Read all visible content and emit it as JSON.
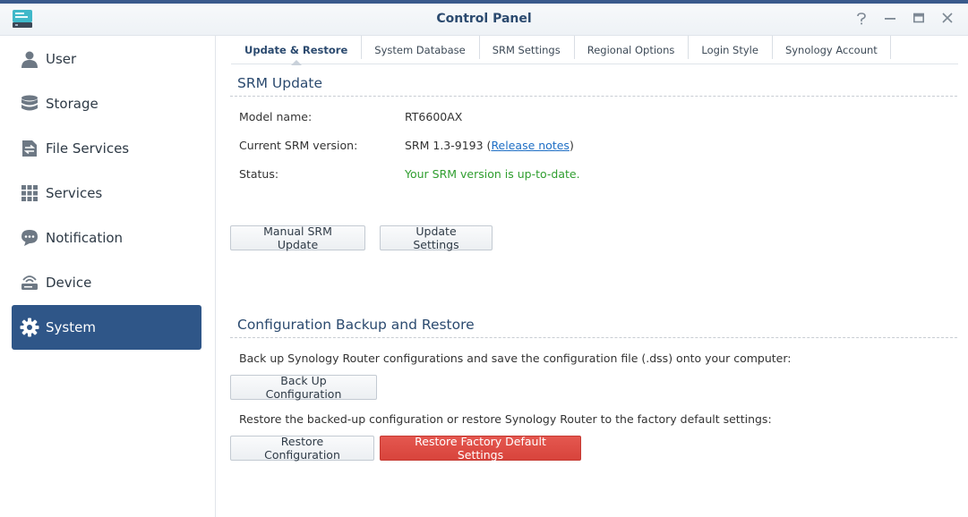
{
  "window": {
    "title": "Control Panel"
  },
  "sidebar": {
    "items": [
      {
        "label": "User",
        "icon": "user-icon"
      },
      {
        "label": "Storage",
        "icon": "storage-icon"
      },
      {
        "label": "File Services",
        "icon": "file-services-icon"
      },
      {
        "label": "Services",
        "icon": "grid-icon"
      },
      {
        "label": "Notification",
        "icon": "chat-bubble-icon"
      },
      {
        "label": "Device",
        "icon": "router-icon"
      },
      {
        "label": "System",
        "icon": "gear-icon",
        "active": true
      }
    ]
  },
  "tabs": [
    {
      "label": "Update & Restore",
      "active": true
    },
    {
      "label": "System Database"
    },
    {
      "label": "SRM Settings"
    },
    {
      "label": "Regional Options"
    },
    {
      "label": "Login Style"
    },
    {
      "label": "Synology Account"
    }
  ],
  "srm_update": {
    "title": "SRM Update",
    "model_label": "Model name:",
    "model_value": "RT6600AX",
    "version_label": "Current SRM version:",
    "version_prefix": "SRM 1.3-9193 (",
    "release_notes": "Release notes",
    "version_suffix": ")",
    "status_label": "Status:",
    "status_value": "Your SRM version is up-to-date.",
    "manual_update_button": "Manual SRM Update",
    "update_settings_button": "Update Settings"
  },
  "backup": {
    "title": "Configuration Backup and Restore",
    "backup_desc": "Back up Synology Router configurations and save the configuration file (.dss) onto your computer:",
    "backup_button": "Back Up Configuration",
    "restore_desc": "Restore the backed-up configuration or restore Synology Router to the factory default settings:",
    "restore_button": "Restore Configuration",
    "factory_button": "Restore Factory Default Settings"
  },
  "colors": {
    "accent": "#2f5688",
    "title": "#2b4a6f",
    "status_ok": "#2f9e2f",
    "danger": "#d8443c",
    "link": "#1f6fc5"
  }
}
